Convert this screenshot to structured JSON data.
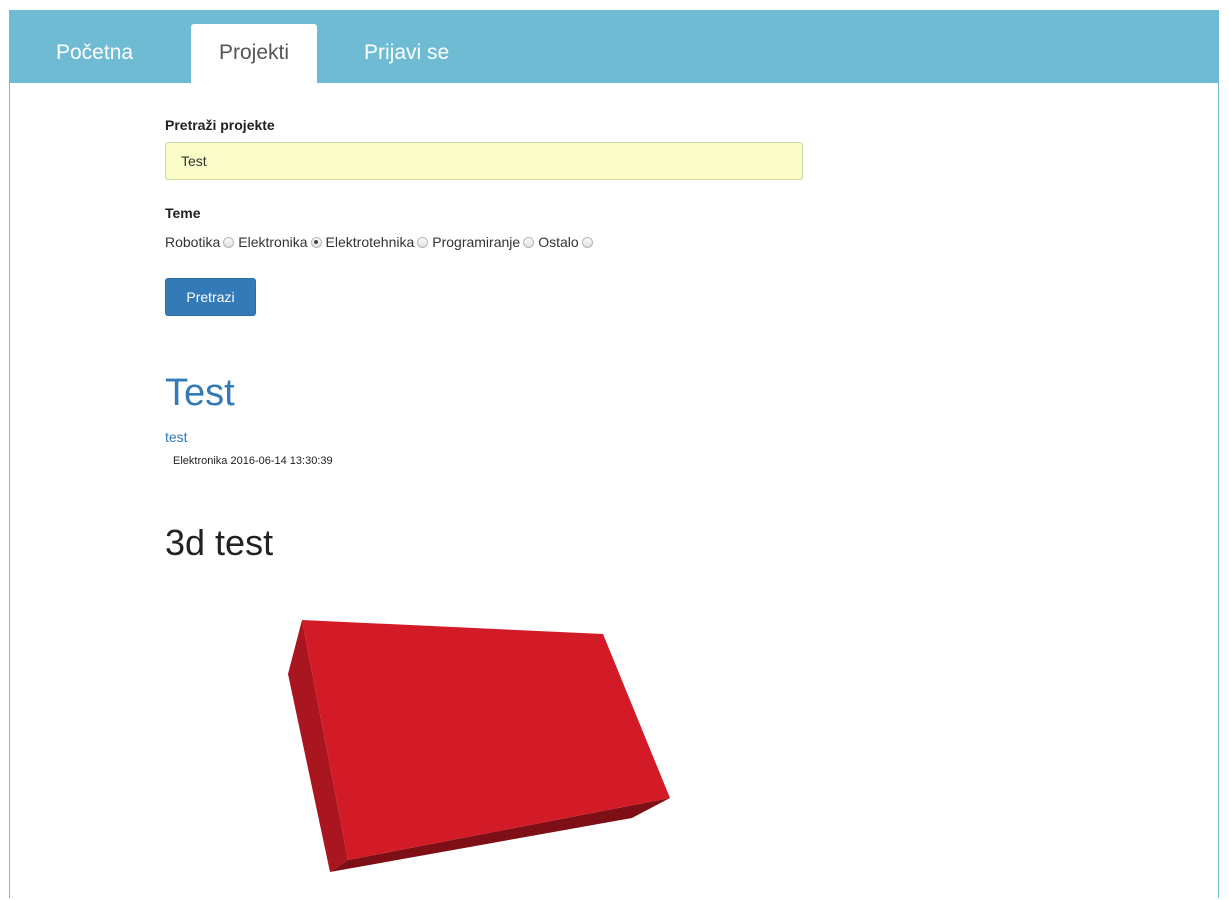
{
  "navbar": {
    "items": [
      {
        "label": "Početna"
      },
      {
        "label": "Projekti"
      },
      {
        "label": "Prijavi se"
      }
    ]
  },
  "search": {
    "label": "Pretraži projekte",
    "value": "Test"
  },
  "topics": {
    "label": "Teme",
    "options": [
      {
        "label": "Robotika",
        "checked": false
      },
      {
        "label": "Elektronika",
        "checked": true
      },
      {
        "label": "Elektrotehnika",
        "checked": false
      },
      {
        "label": "Programiranje",
        "checked": false
      },
      {
        "label": "Ostalo",
        "checked": false
      }
    ]
  },
  "search_button": {
    "label": "Pretrazi"
  },
  "result": {
    "title": "Test",
    "description": "test",
    "meta": "Elektronika 2016-06-14 13:30:39"
  },
  "model_section": {
    "title": "3d test"
  },
  "colors": {
    "navbar": "#6fbbd3",
    "primary": "#337ab7",
    "box_front": "#d31b27",
    "box_side": "#a91620",
    "box_bottom": "#7e0f16"
  }
}
